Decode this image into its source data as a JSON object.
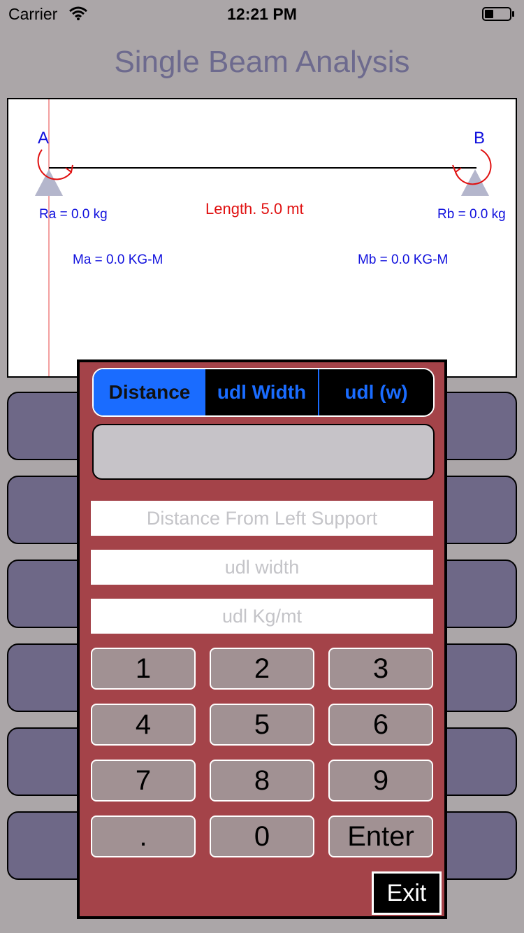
{
  "status_bar": {
    "carrier": "Carrier",
    "time": "12:21 PM"
  },
  "app": {
    "title": "Single Beam Analysis"
  },
  "diagram": {
    "support_a_label": "A",
    "support_b_label": "B",
    "reaction_a": "Ra = 0.0 kg",
    "reaction_b": "Rb = 0.0 kg",
    "length_label": "Length. 5.0 mt",
    "moment_a": "Ma = 0.0 KG-M",
    "moment_b": "Mb = 0.0 KG-M",
    "colors": {
      "labels": "#1010dd",
      "moments": "#e01010",
      "beam": "#000000",
      "support": "#b4b6cc"
    }
  },
  "keypad": {
    "tabs": [
      {
        "label": "Distance",
        "selected": true
      },
      {
        "label": "udl Width",
        "selected": false
      },
      {
        "label": "udl (w)",
        "selected": false
      }
    ],
    "display_value": "",
    "fields": {
      "distance_placeholder": "Distance From Left Support",
      "width_placeholder": "udl width",
      "load_placeholder": "udl Kg/mt"
    },
    "keys": [
      "1",
      "2",
      "3",
      "4",
      "5",
      "6",
      "7",
      "8",
      "9",
      ".",
      "0",
      "Enter"
    ],
    "exit_label": "Exit",
    "colors": {
      "panel": "#a44349",
      "key": "#a19193",
      "accent": "#1a6cff"
    }
  },
  "background": {
    "color": "#aba6a8",
    "slot_color": "#6e6887"
  }
}
